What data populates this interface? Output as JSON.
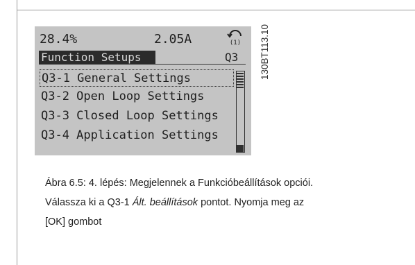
{
  "lcd": {
    "status": {
      "percent": "28.4%",
      "current": "2.05A",
      "setup_icon": "setup-1-icon"
    },
    "header": {
      "title": "Function Setups",
      "code": "Q3"
    },
    "menu": [
      {
        "label": "Q3-1 General Settings",
        "selected": true
      },
      {
        "label": "Q3-2 Open Loop Settings",
        "selected": false
      },
      {
        "label": "Q3-3 Closed Loop Settings",
        "selected": false
      },
      {
        "label": "Q3-4 Application Settings",
        "selected": false
      }
    ],
    "scroll_position": 0
  },
  "figure_code": "130BT113.10",
  "caption": {
    "line1": "Ábra 6.5: 4. lépés: Megjelennek a Funkcióbeállítások opciói.",
    "line2_pre": "Válassza ki a Q3-1 ",
    "line2_em": "Ált. beállítások",
    "line2_post": " pontot. Nyomja meg az",
    "line3": "[OK] gombot"
  },
  "colors": {
    "lcd_bg": "#c4c4c4",
    "lcd_fg": "#202020",
    "header_bg": "#2b2b2b"
  }
}
